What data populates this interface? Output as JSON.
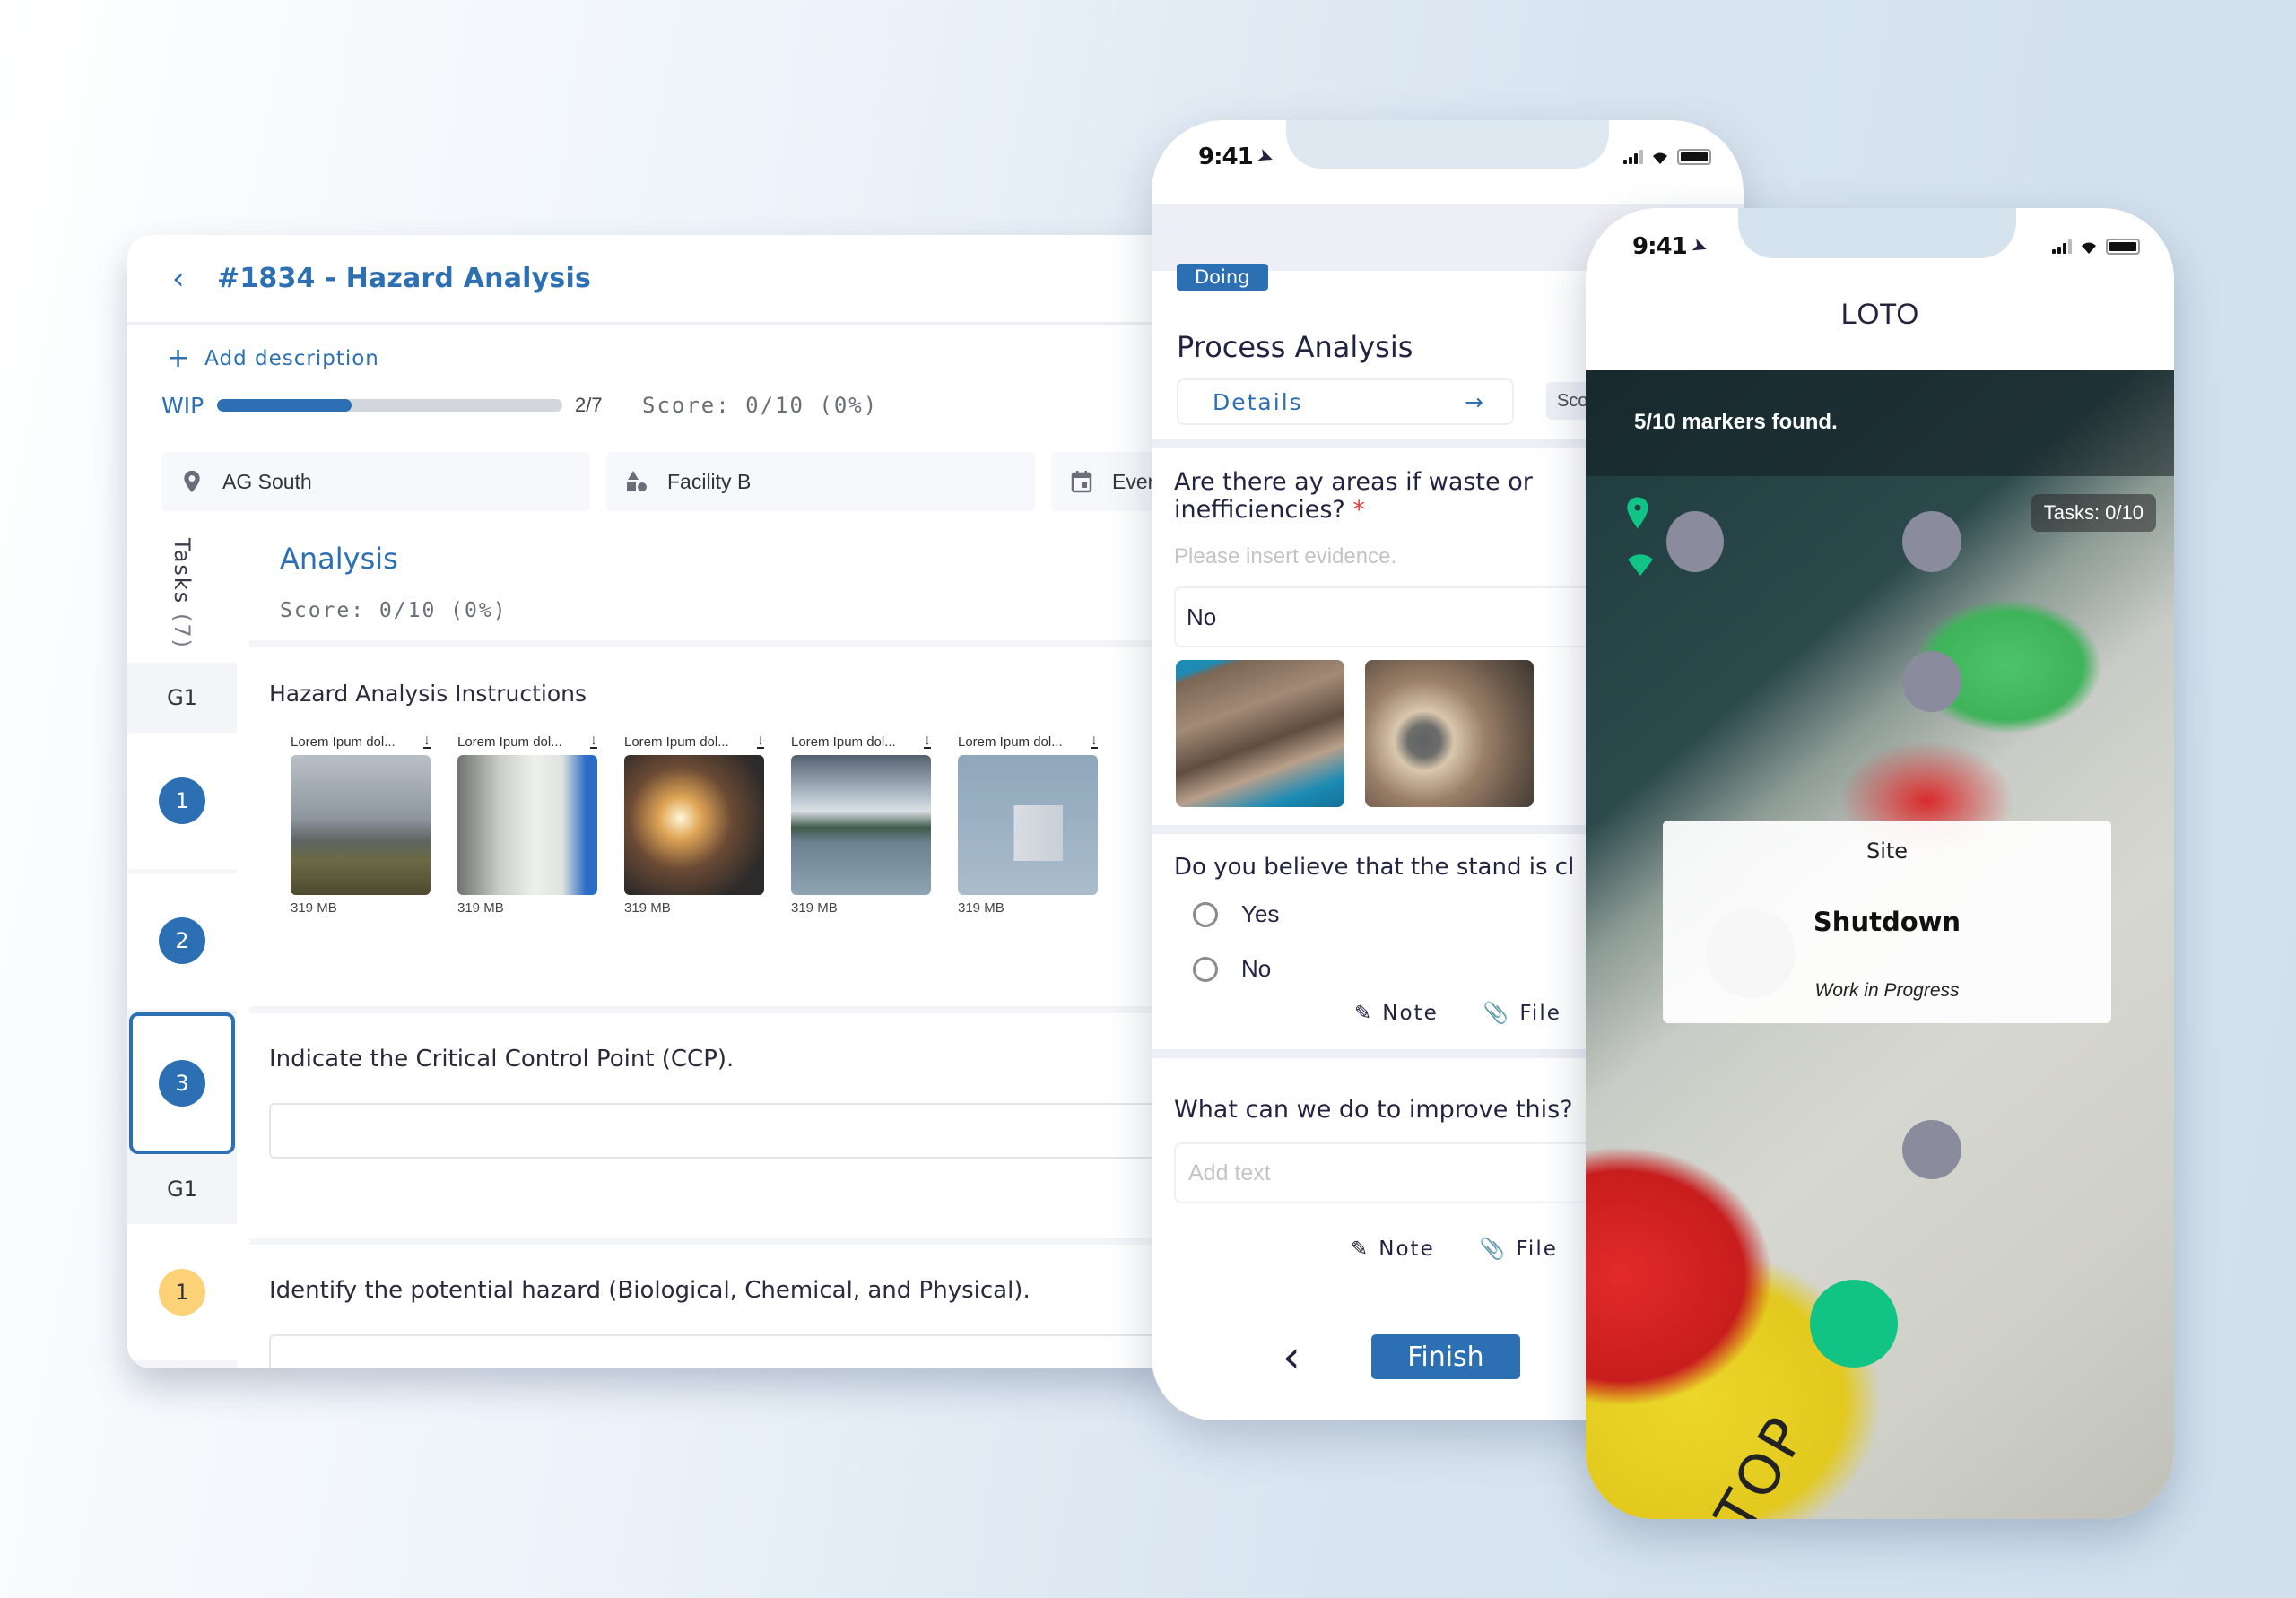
{
  "desktop": {
    "title": "#1834 - Hazard Analysis",
    "add_description": "Add description",
    "status": "WIP",
    "progress": {
      "done": 2,
      "total": 7,
      "label": "2/7",
      "fill_fraction": 0.39
    },
    "score": "Score: 0/10 (0%)",
    "meta": [
      {
        "icon": "location-pin-icon",
        "label": "AG South"
      },
      {
        "icon": "shapes-icon",
        "label": "Facility B"
      },
      {
        "icon": "calendar-icon",
        "label": "Ever"
      }
    ],
    "sidebar": {
      "tasks_label": "Tasks",
      "tasks_count": "(7)",
      "groups": [
        {
          "label": "G1",
          "items": [
            {
              "number": "1",
              "color": "blue"
            },
            {
              "number": "2",
              "color": "blue"
            },
            {
              "number": "3",
              "color": "blue",
              "active": true
            }
          ]
        },
        {
          "label": "G1",
          "items": [
            {
              "number": "1",
              "color": "yellow"
            }
          ]
        }
      ]
    },
    "section": {
      "title": "Analysis",
      "score": "Score: 0/10 (0%)"
    },
    "instructions": {
      "title": "Hazard Analysis Instructions",
      "files": [
        {
          "name": "Lorem Ipum dol...",
          "size": "319 MB"
        },
        {
          "name": "Lorem Ipum dol...",
          "size": "319 MB"
        },
        {
          "name": "Lorem Ipum dol...",
          "size": "319 MB"
        },
        {
          "name": "Lorem Ipum dol...",
          "size": "319 MB"
        },
        {
          "name": "Lorem Ipum dol...",
          "size": "319 MB"
        }
      ]
    },
    "questions": [
      {
        "text": "Indicate the Critical Control Point (CCP).",
        "value": ""
      },
      {
        "text": "Identify the potential hazard (Biological, Chemical, and Physical).",
        "value": ""
      }
    ]
  },
  "phone1": {
    "time": "9:41",
    "badge": "Doing",
    "title": "Process Analysis",
    "details": "Details",
    "score_chip": "Sco",
    "q1": {
      "text": "Are there ay areas if waste or inefficiencies?",
      "required_mark": "*",
      "placeholder": "Please insert evidence.",
      "answer": "No"
    },
    "q2": {
      "text": "Do you believe that the stand is cl",
      "options": [
        "Yes",
        "No"
      ]
    },
    "q3": {
      "text": "What can we do to improve this?",
      "placeholder": "Add text"
    },
    "note": "Note",
    "file": "File",
    "finish": "Finish",
    "brand_color": "#2c6fb2"
  },
  "phone2": {
    "time": "9:41",
    "title": "LOTO",
    "markers_found": "5/10 markers found.",
    "tasks": "Tasks: 0/10",
    "site_card": {
      "label": "Site",
      "title": "Shutdown",
      "status": "Work in Progress"
    },
    "stop_label": "STOP",
    "marker_color": "#12c386"
  }
}
